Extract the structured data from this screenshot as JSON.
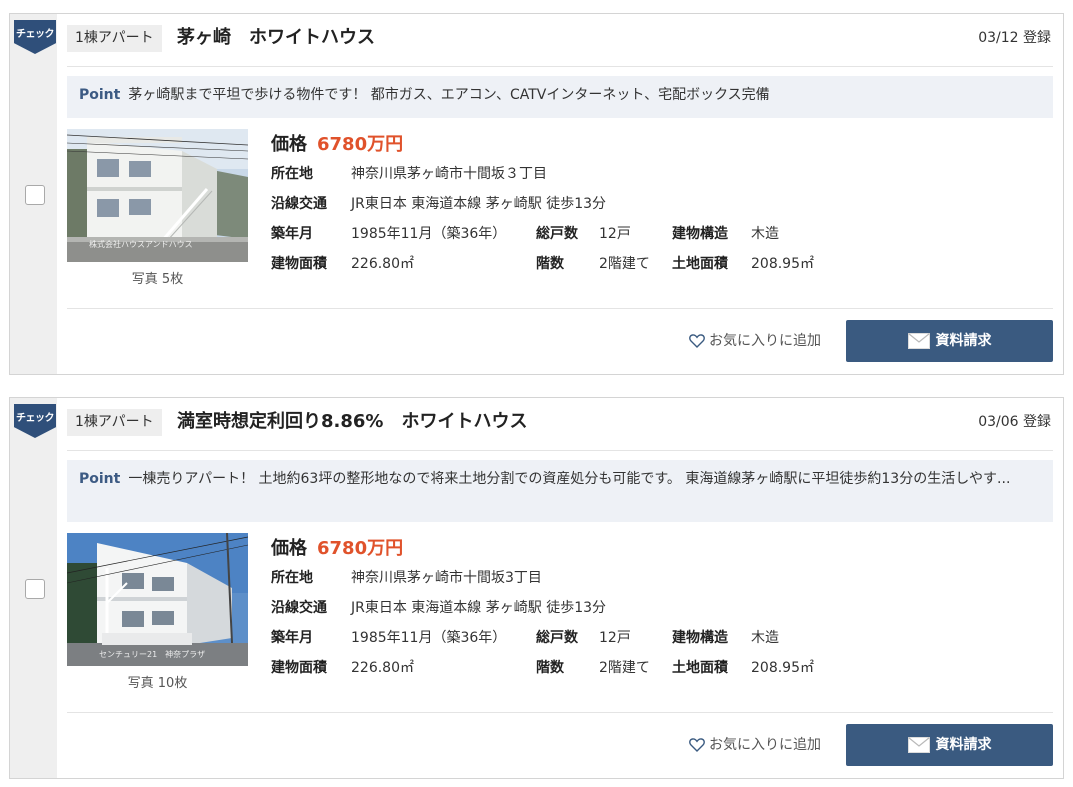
{
  "listings": [
    {
      "check_label": "チェック",
      "type": "1棟アパート",
      "title": "茅ヶ崎　ホワイトハウス",
      "registered": "03/12 登録",
      "point_label": "Point",
      "point_text": "茅ヶ崎駅まで平坦で歩ける物件です！ 都市ガス、エアコン、CATVインターネット、宅配ボックス完備",
      "photo_caption": "写真 5枚",
      "photo_watermark": "株式会社ハウスアンドハウス",
      "price_label": "価格",
      "price": "6780万円",
      "address_label": "所在地",
      "address": "神奈川県茅ヶ崎市十間坂３丁目",
      "transit_label": "沿線交通",
      "transit": "JR東日本 東海道本線 茅ヶ崎駅 徒歩13分",
      "built_label": "築年月",
      "built": "1985年11月（築36年）",
      "units_label": "総戸数",
      "units": "12戸",
      "structure_label": "建物構造",
      "structure": "木造",
      "floor_area_label": "建物面積",
      "floor_area": "226.80㎡",
      "floors_label": "階数",
      "floors": "2階建て",
      "land_area_label": "土地面積",
      "land_area": "208.95㎡",
      "favorite_label": "お気に入りに追加",
      "request_label": "資料請求"
    },
    {
      "check_label": "チェック",
      "type": "1棟アパート",
      "title": "満室時想定利回り8.86%　ホワイトハウス",
      "registered": "03/06 登録",
      "point_label": "Point",
      "point_text": "一棟売りアパート！ 土地約63坪の整形地なので将来土地分割での資産処分も可能です。 東海道線茅ヶ崎駅に平坦徒歩約13分の生活しやす...",
      "photo_caption": "写真 10枚",
      "photo_watermark": "センチュリー21　神奈プラザ",
      "price_label": "価格",
      "price": "6780万円",
      "address_label": "所在地",
      "address": "神奈川県茅ヶ崎市十間坂3丁目",
      "transit_label": "沿線交通",
      "transit": "JR東日本 東海道本線 茅ヶ崎駅 徒歩13分",
      "built_label": "築年月",
      "built": "1985年11月（築36年）",
      "units_label": "総戸数",
      "units": "12戸",
      "structure_label": "建物構造",
      "structure": "木造",
      "floor_area_label": "建物面積",
      "floor_area": "226.80㎡",
      "floors_label": "階数",
      "floors": "2階建て",
      "land_area_label": "土地面積",
      "land_area": "208.95㎡",
      "favorite_label": "お気に入りに追加",
      "request_label": "資料請求"
    }
  ],
  "colors": {
    "brand_navy": "#3a5a80",
    "price_red": "#e0522b",
    "point_bg": "#eef1f6"
  },
  "icons": {
    "check_flag": "bookmark-ribbon",
    "favorite": "heart-outline-icon",
    "request": "envelope-icon"
  }
}
